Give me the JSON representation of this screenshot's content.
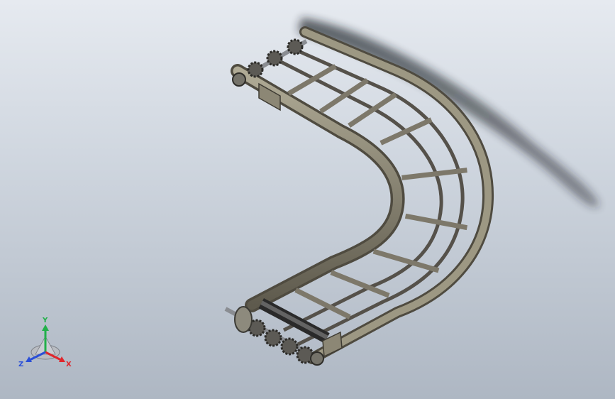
{
  "viewport": {
    "background_top": "#e6eaf0",
    "background_bottom": "#aeb7c3"
  },
  "model": {
    "description_icon": "curved-roller-conveyor-model",
    "frame_color": "#6e6a5c",
    "frame_highlight": "#a8a38f",
    "shaft_color": "#8a8d92"
  },
  "triad": {
    "y_label": "Y",
    "z_label": "Z",
    "x_label": "X",
    "y_color": "#22b04a",
    "x_color": "#e0262c",
    "z_color": "#2a4fd8"
  }
}
